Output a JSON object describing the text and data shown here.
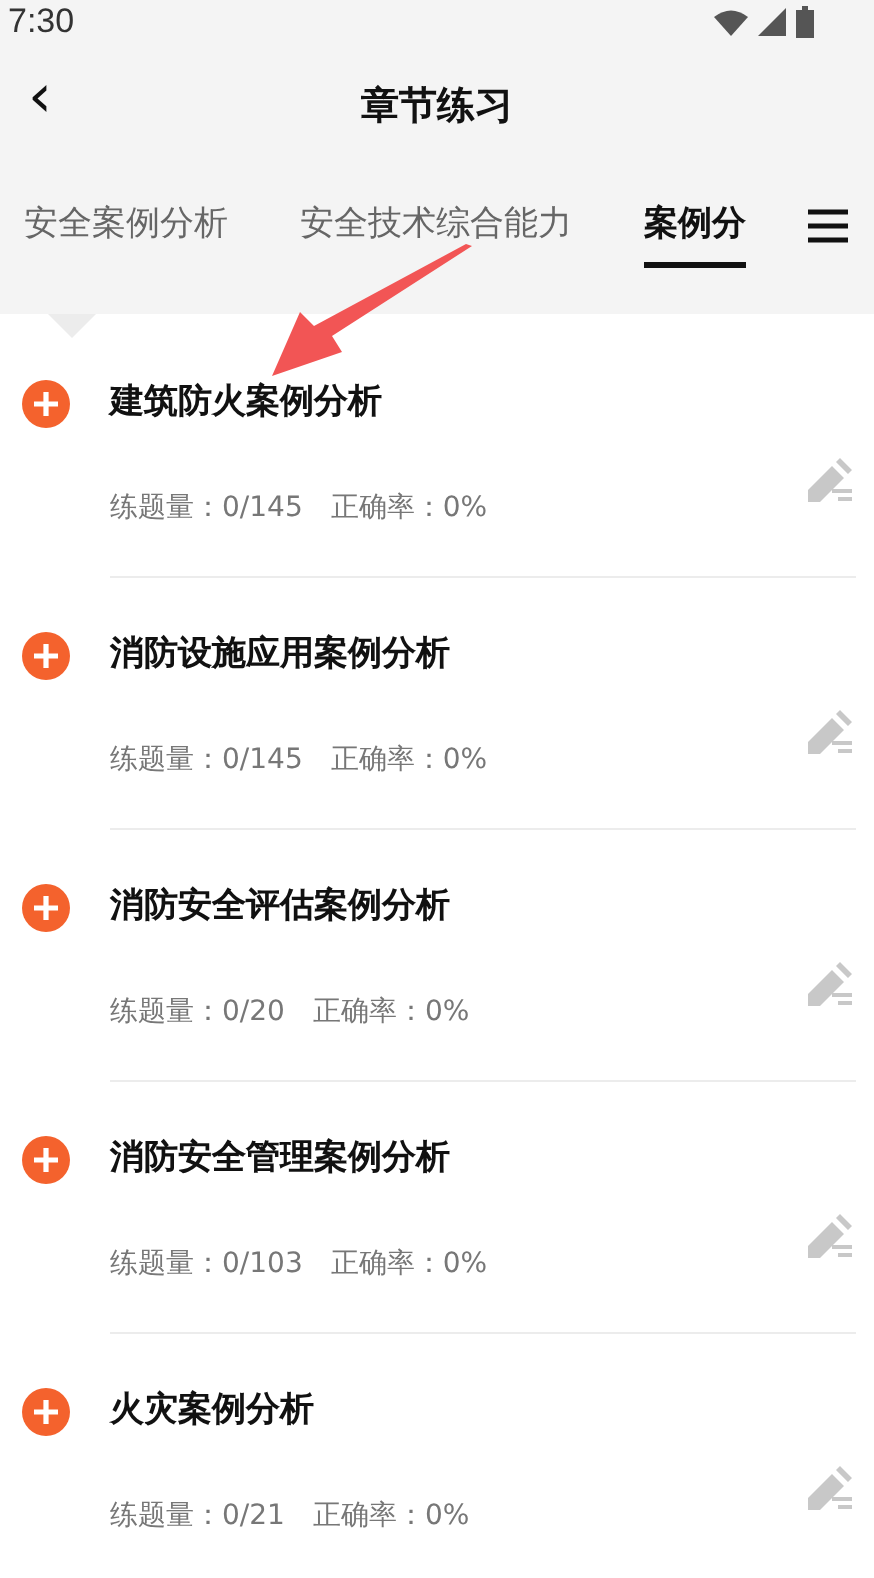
{
  "status_bar": {
    "time": "7:30"
  },
  "header": {
    "back": "‹",
    "title": "章节练习"
  },
  "tabs": [
    {
      "label": "安全案例分析",
      "selected": false
    },
    {
      "label": "安全技术综合能力",
      "selected": false
    },
    {
      "label": "案例分",
      "selected": true
    }
  ],
  "chapters": [
    {
      "title": "建筑防火案例分析",
      "count_label": "练题量：0/145",
      "accuracy_label": "正确率：0%"
    },
    {
      "title": "消防设施应用案例分析",
      "count_label": "练题量：0/145",
      "accuracy_label": "正确率：0%"
    },
    {
      "title": "消防安全评估案例分析",
      "count_label": "练题量：0/20",
      "accuracy_label": "正确率：0%"
    },
    {
      "title": "消防安全管理案例分析",
      "count_label": "练题量：0/103",
      "accuracy_label": "正确率：0%"
    },
    {
      "title": "火灾案例分析",
      "count_label": "练题量：0/21",
      "accuracy_label": "正确率：0%"
    }
  ]
}
